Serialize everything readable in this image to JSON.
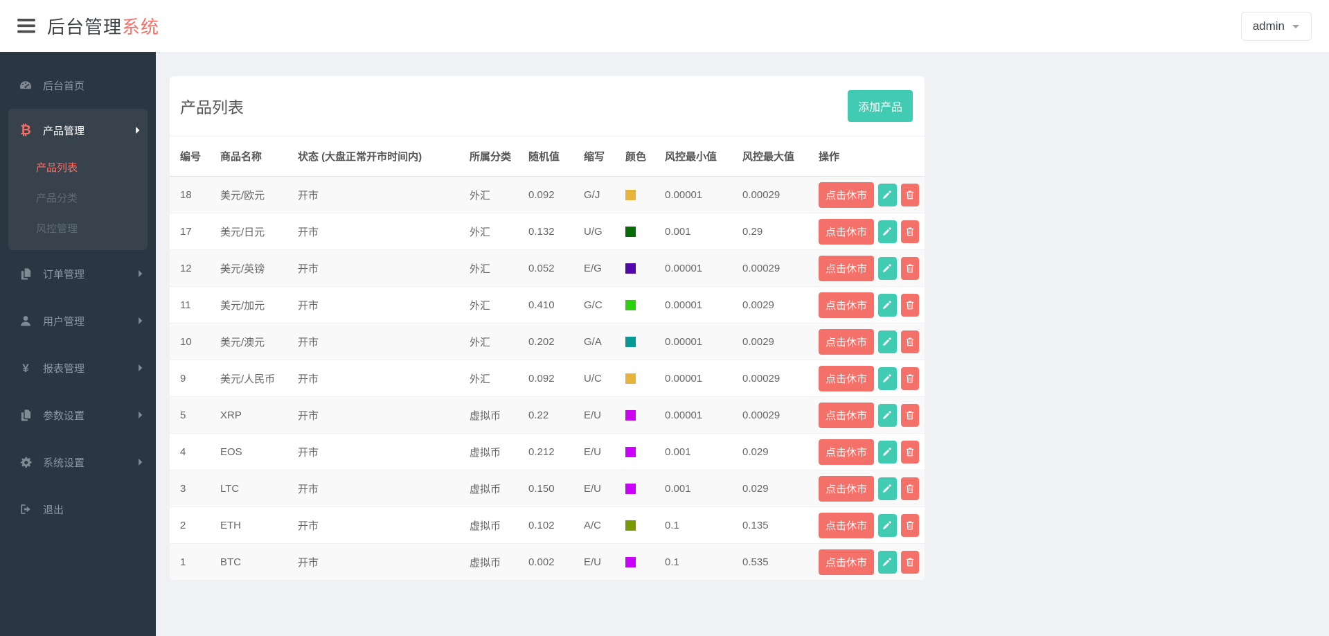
{
  "header": {
    "brand_primary": "后台管理",
    "brand_accent": "系统",
    "user_menu": "admin"
  },
  "theme": {
    "accent_coral": "#f4716a",
    "accent_teal": "#41cbb2",
    "sidebar_bg": "#2b3643",
    "sidebar_group_bg": "#37424d",
    "content_bg": "#eff1f5"
  },
  "sidebar": {
    "items": [
      {
        "id": "home",
        "label": "后台首页",
        "icon": "dashboard-icon"
      },
      {
        "id": "products",
        "label": "产品管理",
        "icon": "bitcoin-icon",
        "expanded": true,
        "children": [
          {
            "id": "product-list",
            "label": "产品列表",
            "active": true
          },
          {
            "id": "product-category",
            "label": "产品分类",
            "active": false
          },
          {
            "id": "risk-management",
            "label": "风控管理",
            "active": false
          }
        ]
      },
      {
        "id": "orders",
        "label": "订单管理",
        "icon": "orders-icon",
        "has_children": true
      },
      {
        "id": "users",
        "label": "用户管理",
        "icon": "user-icon",
        "has_children": true
      },
      {
        "id": "reports",
        "label": "报表管理",
        "icon": "yen-icon",
        "has_children": true
      },
      {
        "id": "params",
        "label": "参数设置",
        "icon": "params-icon",
        "has_children": true
      },
      {
        "id": "system",
        "label": "系统设置",
        "icon": "gears-icon",
        "has_children": true
      },
      {
        "id": "logout",
        "label": "退出",
        "icon": "logout-icon"
      }
    ]
  },
  "main": {
    "card_title": "产品列表",
    "add_button": "添加产品",
    "table": {
      "headers": [
        "编号",
        "商品名称",
        "状态 (大盘正常开市时间内)",
        "所属分类",
        "随机值",
        "缩写",
        "颜色",
        "风控最小值",
        "风控最大值",
        "操作"
      ],
      "action_labels": {
        "close_market": "点击休市",
        "edit_icon": "pencil-icon",
        "delete_icon": "trash-icon"
      },
      "rows": [
        {
          "id": "18",
          "name": "美元/欧元",
          "status": "开市",
          "category": "外汇",
          "random": "0.092",
          "abbr": "G/J",
          "color": "#e8b33b",
          "risk_min": "0.00001",
          "risk_max": "0.00029"
        },
        {
          "id": "17",
          "name": "美元/日元",
          "status": "开市",
          "category": "外汇",
          "random": "0.132",
          "abbr": "U/G",
          "color": "#066c08",
          "risk_min": "0.001",
          "risk_max": "0.29"
        },
        {
          "id": "12",
          "name": "美元/英镑",
          "status": "开市",
          "category": "外汇",
          "random": "0.052",
          "abbr": "E/G",
          "color": "#5408ab",
          "risk_min": "0.00001",
          "risk_max": "0.00029"
        },
        {
          "id": "11",
          "name": "美元/加元",
          "status": "开市",
          "category": "外汇",
          "random": "0.410",
          "abbr": "G/C",
          "color": "#2dd20e",
          "risk_min": "0.00001",
          "risk_max": "0.0029"
        },
        {
          "id": "10",
          "name": "美元/澳元",
          "status": "开市",
          "category": "外汇",
          "random": "0.202",
          "abbr": "G/A",
          "color": "#089894",
          "risk_min": "0.00001",
          "risk_max": "0.0029"
        },
        {
          "id": "9",
          "name": "美元/人民币",
          "status": "开市",
          "category": "外汇",
          "random": "0.092",
          "abbr": "U/C",
          "color": "#e8b33b",
          "risk_min": "0.00001",
          "risk_max": "0.00029"
        },
        {
          "id": "5",
          "name": "XRP",
          "status": "开市",
          "category": "虚拟币",
          "random": "0.22",
          "abbr": "E/U",
          "color": "#cb05ee",
          "risk_min": "0.00001",
          "risk_max": "0.00029"
        },
        {
          "id": "4",
          "name": "EOS",
          "status": "开市",
          "category": "虚拟币",
          "random": "0.212",
          "abbr": "E/U",
          "color": "#cb00fa",
          "risk_min": "0.001",
          "risk_max": "0.029"
        },
        {
          "id": "3",
          "name": "LTC",
          "status": "开市",
          "category": "虚拟币",
          "random": "0.150",
          "abbr": "E/U",
          "color": "#cb00fa",
          "risk_min": "0.001",
          "risk_max": "0.029"
        },
        {
          "id": "2",
          "name": "ETH",
          "status": "开市",
          "category": "虚拟币",
          "random": "0.102",
          "abbr": "A/C",
          "color": "#7a9a02",
          "risk_min": "0.1",
          "risk_max": "0.135"
        },
        {
          "id": "1",
          "name": "BTC",
          "status": "开市",
          "category": "虚拟币",
          "random": "0.002",
          "abbr": "E/U",
          "color": "#c704f8",
          "risk_min": "0.1",
          "risk_max": "0.535"
        }
      ]
    }
  }
}
